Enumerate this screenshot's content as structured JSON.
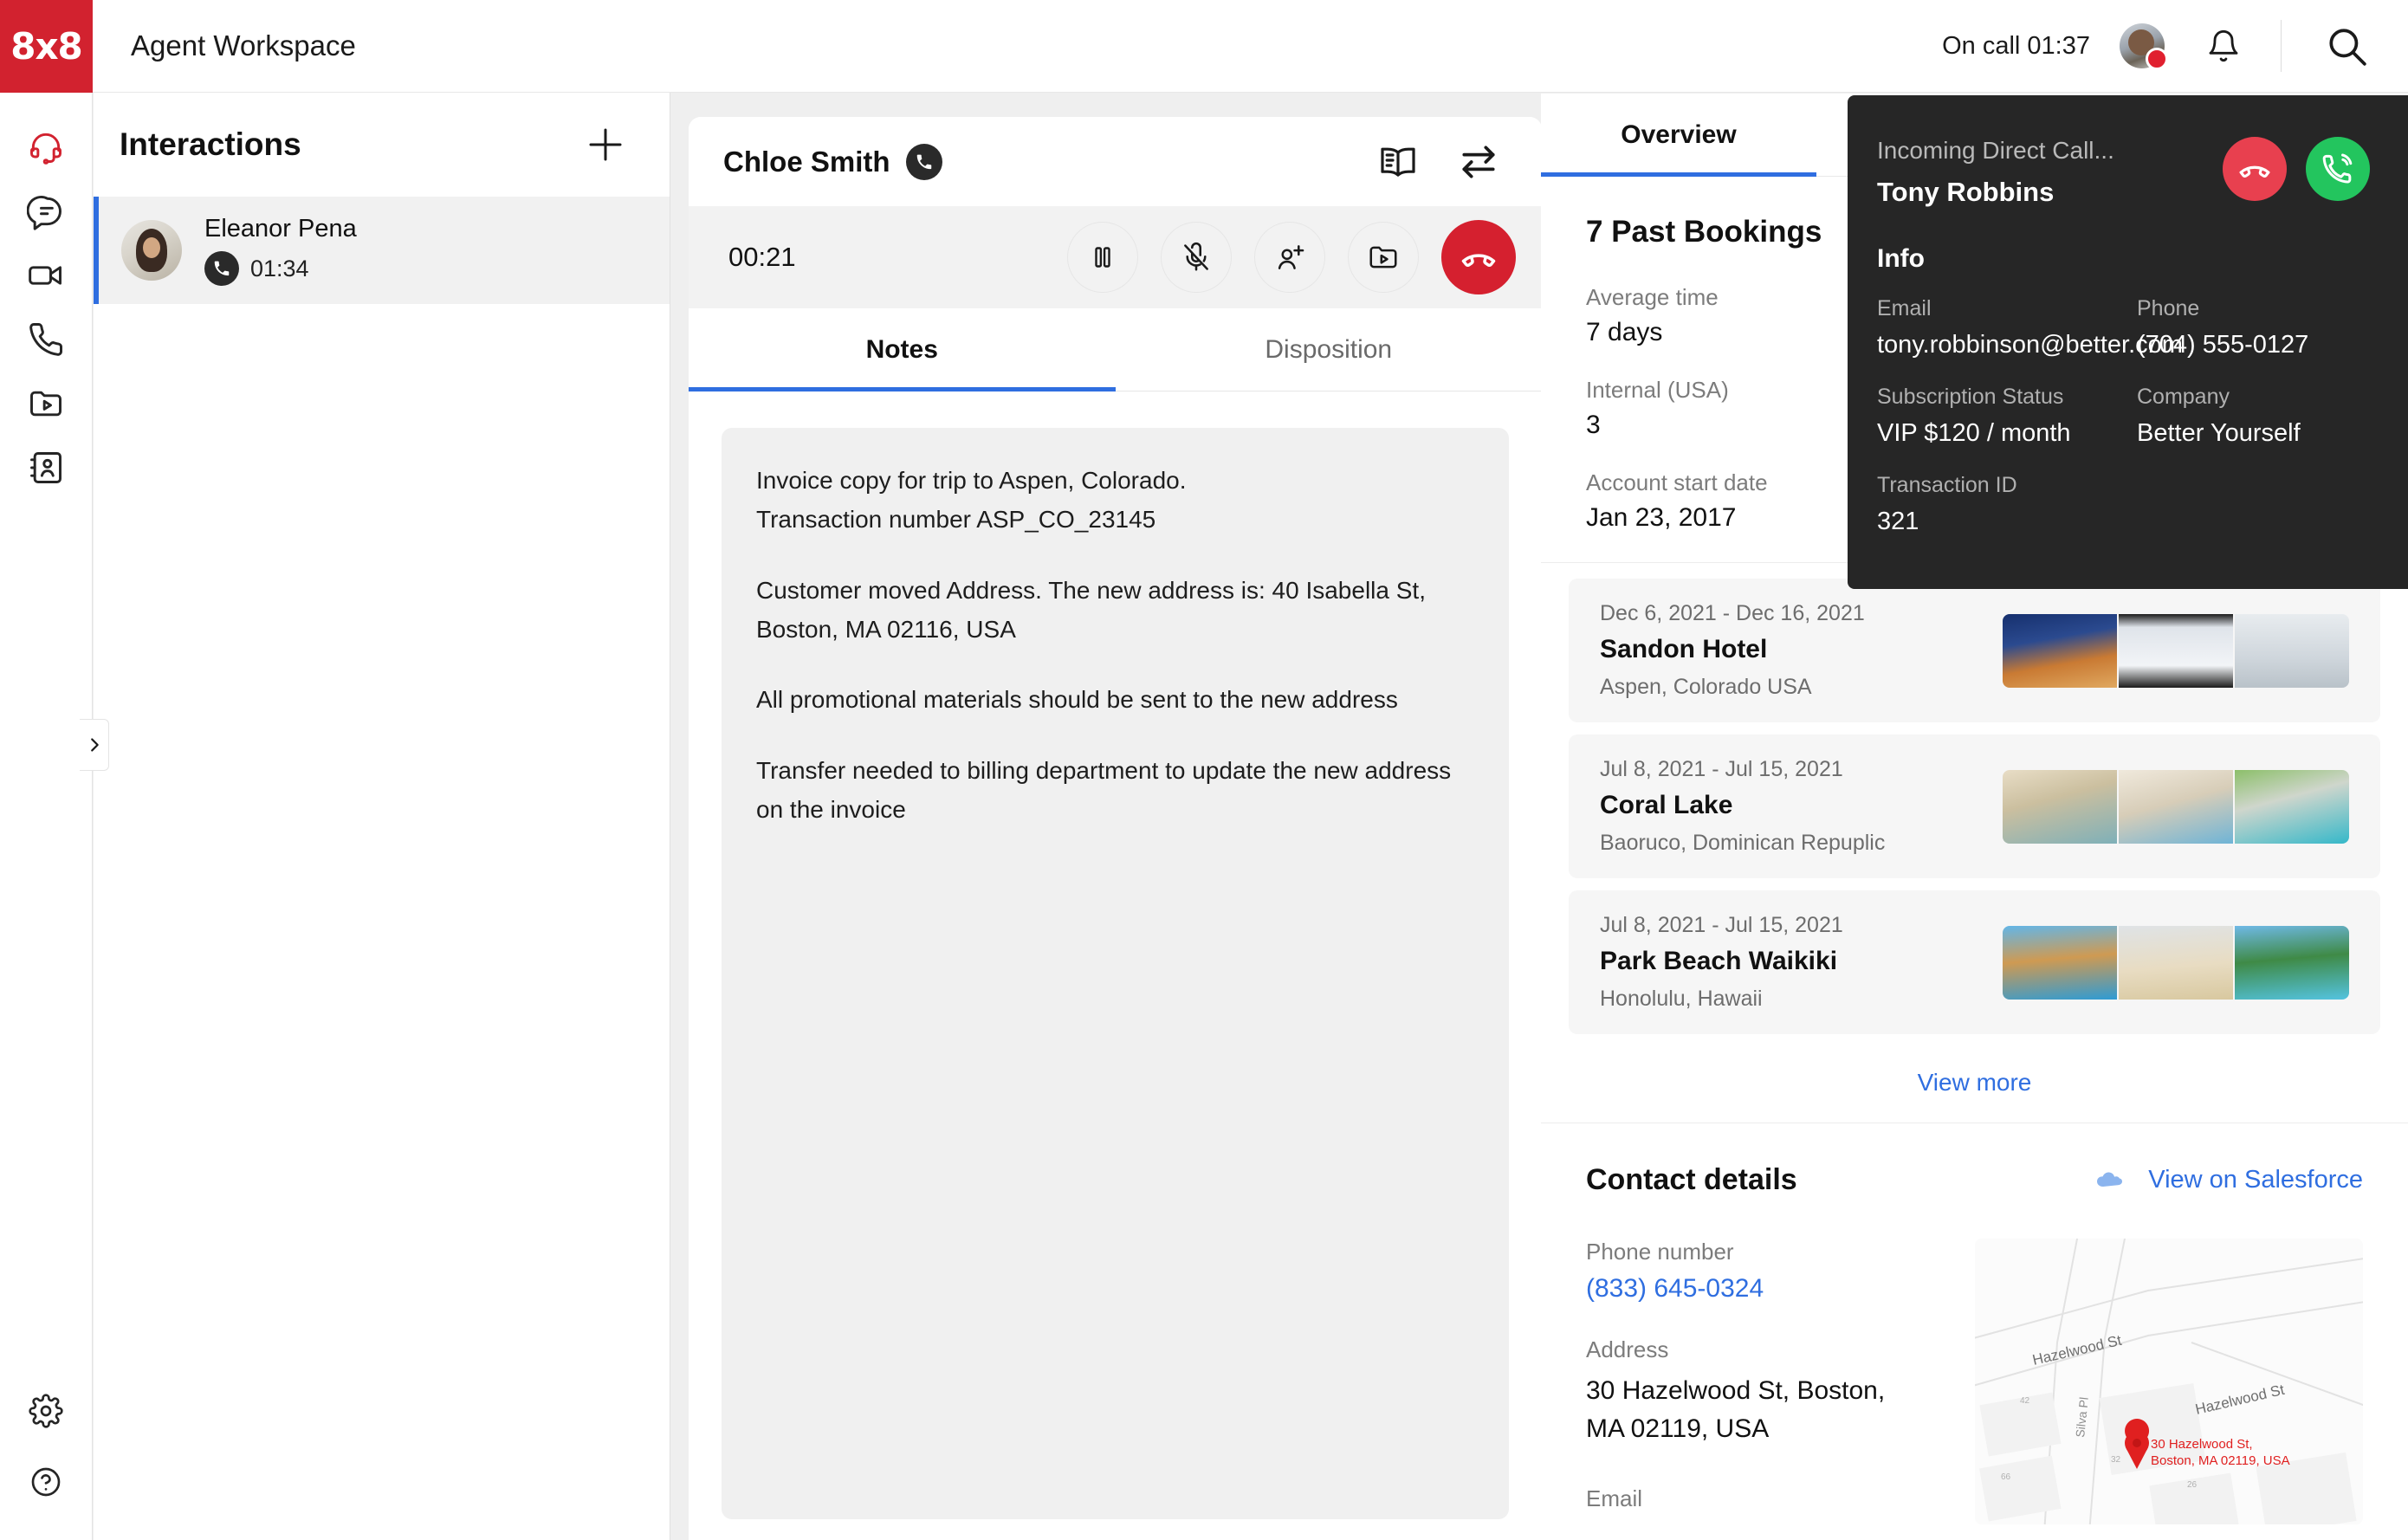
{
  "header": {
    "logo_text": "8x8",
    "app_title": "Agent Workspace",
    "call_status": "On call 01:37",
    "avatar_icon": "agent-avatar",
    "bell_icon": "notification-bell-icon",
    "search_icon": "search-icon"
  },
  "rail": {
    "items": [
      {
        "name": "headset",
        "label": "Contact Center",
        "active": true
      },
      {
        "name": "chat",
        "label": "Chat",
        "active": false
      },
      {
        "name": "video",
        "label": "Video",
        "active": false
      },
      {
        "name": "phone",
        "label": "Phone",
        "active": false
      },
      {
        "name": "recordings",
        "label": "Recordings",
        "active": false
      },
      {
        "name": "contacts",
        "label": "Contacts",
        "active": false
      }
    ],
    "bottom": [
      {
        "name": "settings",
        "label": "Settings"
      },
      {
        "name": "help",
        "label": "Help"
      }
    ],
    "collapse_icon": "chevron-right-icon"
  },
  "interactions": {
    "title": "Interactions",
    "add_icon": "plus-icon",
    "items": [
      {
        "name": "Eleanor Pena",
        "duration": "01:34",
        "channel_icon": "phone-icon",
        "selected": true
      }
    ]
  },
  "call": {
    "contact_name": "Chloe Smith",
    "channel_icon": "phone-icon",
    "knowledge_icon": "book-icon",
    "transfer_icon": "transfer-arrows-icon",
    "timer": "00:21",
    "controls": [
      {
        "name": "hold",
        "icon": "pause-icon",
        "label": "Hold"
      },
      {
        "name": "mute",
        "icon": "microphone-muted-icon",
        "label": "Mute"
      },
      {
        "name": "add-participant",
        "icon": "person-add-icon",
        "label": "Add participant"
      },
      {
        "name": "record",
        "icon": "record-folder-icon",
        "label": "Record"
      },
      {
        "name": "end-call",
        "icon": "phone-hangup-icon",
        "label": "End call"
      }
    ],
    "tabs": [
      {
        "label": "Notes",
        "active": true
      },
      {
        "label": "Disposition",
        "active": false
      }
    ],
    "notes": [
      "Invoice copy for trip to Aspen, Colorado.\nTransaction number ASP_CO_23145",
      "Customer moved Address. The new address is: 40 Isabella St, Boston, MA 02116, USA",
      "All promotional materials should be sent to the new address",
      "Transfer needed to billing department to update the new address on the invoice"
    ]
  },
  "right_panel": {
    "tabs": [
      {
        "label": "Overview",
        "active": true
      }
    ],
    "overview": {
      "heading": "7 Past Bookings",
      "stats": [
        {
          "label": "Average time",
          "value": "7 days"
        },
        {
          "label": "Internal (USA)",
          "value": "3"
        },
        {
          "label": "Account start date",
          "value": "Jan 23, 2017"
        }
      ]
    },
    "bookings": [
      {
        "dates": "Dec 6, 2021 - Dec 16, 2021",
        "name": "Sandon Hotel",
        "location": "Aspen, Colorado USA"
      },
      {
        "dates": "Jul 8, 2021 - Jul 15, 2021",
        "name": "Coral Lake",
        "location": "Baoruco, Dominican Repuplic"
      },
      {
        "dates": "Jul 8, 2021 - Jul 15, 2021",
        "name": "Park Beach Waikiki",
        "location": "Honolulu, Hawaii"
      }
    ],
    "view_more": "View more",
    "contact": {
      "title": "Contact details",
      "salesforce_link": "View on Salesforce",
      "salesforce_icon": "salesforce-cloud-icon",
      "phone_label": "Phone number",
      "phone_value": "(833) 645-0324",
      "address_label": "Address",
      "address_value": "30 Hazelwood St, Boston, MA 02119, USA",
      "email_label": "Email",
      "map_pin_label": "30 Hazelwood St,\nBoston, MA 02119, USA",
      "map_streets": [
        "Hazelwood St",
        "Hazelwood St",
        "Silva Pl"
      ]
    }
  },
  "popup": {
    "subtitle": "Incoming Direct Call...",
    "caller_name": "Tony Robbins",
    "decline_icon": "phone-hangup-icon",
    "accept_icon": "phone-answer-icon",
    "info_title": "Info",
    "fields": [
      {
        "label": "Email",
        "value": "tony.robbinson@better.com"
      },
      {
        "label": "Phone",
        "value": "(704) 555-0127"
      },
      {
        "label": "Subscription Status",
        "value": "VIP $120 / month"
      },
      {
        "label": "Company",
        "value": "Better Yourself"
      },
      {
        "label": "Transaction ID",
        "value": "321"
      }
    ]
  },
  "colors": {
    "brand_red": "#d2222f",
    "accent_blue": "#2f6ee0",
    "end_call_red": "#d5202f",
    "accept_green": "#23c55e",
    "decline_red": "#e8404f",
    "popup_bg": "#262626"
  }
}
